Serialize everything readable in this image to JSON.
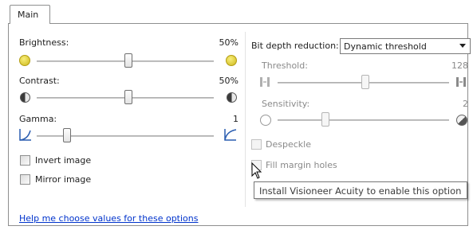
{
  "tabs": [
    {
      "label": "Main"
    }
  ],
  "left": {
    "brightness": {
      "label": "Brightness:",
      "value": "50%"
    },
    "contrast": {
      "label": "Contrast:",
      "value": "50%"
    },
    "gamma": {
      "label": "Gamma:",
      "value": "1"
    },
    "invert_image": {
      "label": "Invert image",
      "checked": false
    },
    "mirror_image": {
      "label": "Mirror image",
      "checked": false
    }
  },
  "right": {
    "bit_depth_label": "Bit depth reduction:",
    "bit_depth_selected": "Dynamic threshold",
    "threshold": {
      "label": "Threshold:",
      "value": "128"
    },
    "sensitivity": {
      "label": "Sensitivity:",
      "value": "2"
    },
    "despeckle": {
      "label": "Despeckle",
      "checked": false,
      "enabled": false
    },
    "fill_margin_holes": {
      "label": "Fill margin holes",
      "checked": false,
      "enabled": false
    }
  },
  "tooltip": "Install Visioneer Acuity to enable this option",
  "help_link": "Help me choose values for these options",
  "colors": {
    "link": "#0033cc",
    "disabled_text": "#8a8a8a",
    "border": "#8e8f8f"
  }
}
